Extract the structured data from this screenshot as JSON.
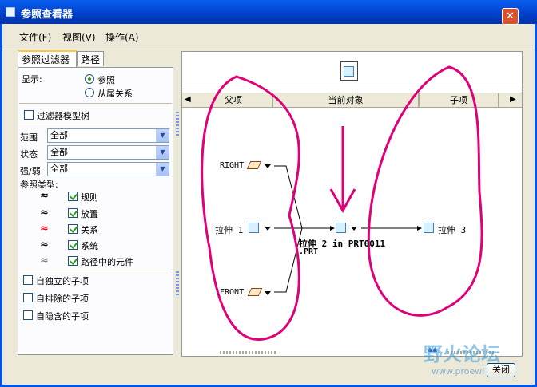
{
  "window": {
    "title": "参照查看器",
    "close_glyph": "✕"
  },
  "menu": [
    "文件(F)",
    "视图(V)",
    "操作(A)"
  ],
  "tabs": [
    "参照过滤器",
    "路径"
  ],
  "display": {
    "label": "显示:",
    "options": [
      {
        "label": "参照",
        "selected": true
      },
      {
        "label": "从属关系",
        "selected": false
      }
    ]
  },
  "filter_tree": {
    "label": "过滤器模型树",
    "checked": false
  },
  "filters": [
    {
      "label": "范围",
      "value": "全部"
    },
    {
      "label": "状态",
      "value": "全部"
    },
    {
      "label": "强/弱",
      "value": "全部"
    }
  ],
  "ref_types": {
    "label": "参照类型:",
    "items": [
      {
        "label": "规则",
        "checked": true,
        "color": "#000000"
      },
      {
        "label": "放置",
        "checked": true,
        "color": "#000000"
      },
      {
        "label": "关系",
        "checked": true,
        "color": "#e0001b"
      },
      {
        "label": "系统",
        "checked": true,
        "color": "#000000"
      },
      {
        "label": "路径中的元件",
        "checked": true,
        "color": "#808080"
      }
    ]
  },
  "children_opts": [
    {
      "label": "自独立的子项",
      "checked": false
    },
    {
      "label": "自排除的子项",
      "checked": false
    },
    {
      "label": "自隐含的子项",
      "checked": false
    }
  ],
  "columns": [
    "父项",
    "当前对象",
    "子项"
  ],
  "graph": {
    "parents": [
      {
        "label": "RIGHT",
        "icon": "datum-plane-icon"
      },
      {
        "label": "拉伸 1",
        "icon": "feature-icon"
      },
      {
        "label": "FRONT",
        "icon": "datum-plane-icon"
      }
    ],
    "current": {
      "label": "拉伸 2 in PRT0011",
      "label2": ".PRT"
    },
    "children": [
      {
        "label": "拉伸 3",
        "icon": "feature-icon"
      }
    ]
  },
  "footer": {
    "close_label": "关闭"
  },
  "watermark": {
    "text": "野火论坛",
    "url": "www.proewi"
  }
}
